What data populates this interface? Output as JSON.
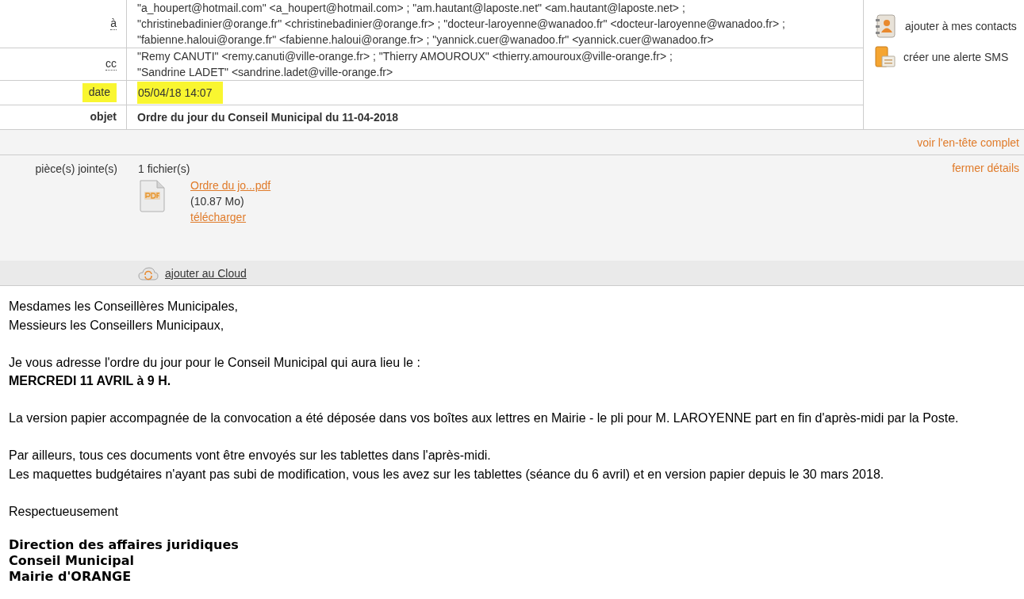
{
  "header": {
    "rows": [
      {
        "label": "à",
        "lines": [
          "\"a_houpert@hotmail.com\" <a_houpert@hotmail.com> ;  \"am.hautant@laposte.net\" <am.hautant@laposte.net> ;",
          "\"christinebadinier@orange.fr\" <christinebadinier@orange.fr> ;  \"docteur-laroyenne@wanadoo.fr\" <docteur-laroyenne@wanadoo.fr> ;",
          "\"fabienne.haloui@orange.fr\" <fabienne.haloui@orange.fr> ;  \"yannick.cuer@wanadoo.fr\" <yannick.cuer@wanadoo.fr>"
        ],
        "kind": "recipients",
        "highlighted": false
      },
      {
        "label": "cc",
        "lines": [
          "\"Remy CANUTI\" <remy.canuti@ville-orange.fr> ;  \"Thierry AMOUROUX\" <thierry.amouroux@ville-orange.fr> ;",
          "\"Sandrine LADET\" <sandrine.ladet@ville-orange.fr>"
        ],
        "kind": "recipients",
        "highlighted": false
      },
      {
        "label": "date",
        "lines": [
          "05/04/18 14:07"
        ],
        "kind": "plain",
        "highlighted": true
      },
      {
        "label": "objet",
        "lines": [
          "Ordre du jour du Conseil Municipal du 11-04-2018"
        ],
        "kind": "subject",
        "highlighted": false
      }
    ],
    "actions": [
      {
        "label": "ajouter à mes contacts",
        "kind": "contacts"
      },
      {
        "label": "créer une alerte SMS",
        "kind": "sms"
      }
    ]
  },
  "full_header_link": "voir l'en-tête complet",
  "attachments": {
    "label": "pièce(s) jointe(s)",
    "count": "1 fichier(s)",
    "close_link": "fermer détails",
    "file": {
      "name": "Ordre du jo...pdf",
      "size": "(10.87 Mo)",
      "download": "télécharger"
    }
  },
  "cloud_link": "ajouter au Cloud",
  "body": {
    "paragraphs": [
      [
        "Mesdames les Conseillères Municipales,",
        "Messieurs les Conseillers Municipaux,"
      ],
      [
        "Je vous adresse l'ordre du jour pour le Conseil Municipal qui aura lieu le :",
        "**MERCREDI 11 AVRIL à 9 H.**"
      ],
      [
        "La version papier accompagnée de la convocation a été déposée dans vos boîtes aux lettres en Mairie - le pli pour M. LAROYENNE part en fin d'après-midi par la Poste."
      ],
      [
        "Par ailleurs, tous ces documents vont être envoyés sur les tablettes dans l'après-midi.",
        "Les maquettes budgétaires n'ayant pas subi de modification, vous les avez sur les tablettes (séance du 6 avril) et en version papier depuis le 30 mars 2018."
      ],
      [
        "Respectueusement"
      ]
    ],
    "signature": [
      "Direction des affaires juridiques",
      "Conseil Municipal",
      "Mairie d'ORANGE"
    ]
  }
}
